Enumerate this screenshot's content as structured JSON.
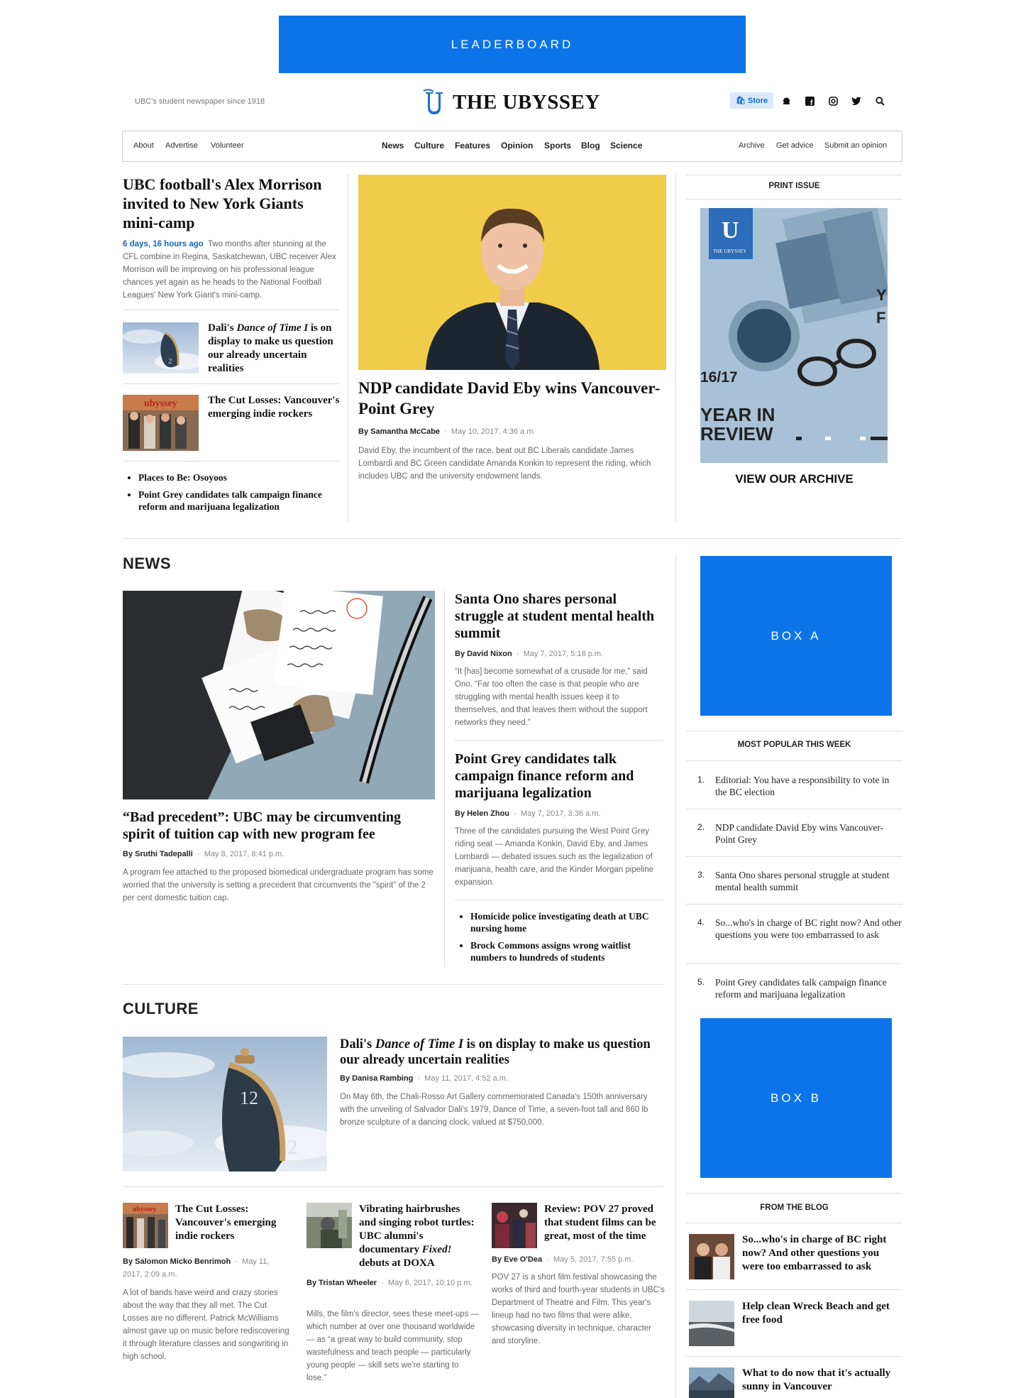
{
  "ads": {
    "leaderboard": "LEADERBOARD",
    "box_a": "BOX A",
    "box_b": "BOX B"
  },
  "header": {
    "tagline": "UBC's student newspaper since 1918",
    "logo_text": "THE UBYSSEY",
    "store_label": "Store",
    "icons": [
      "snapchat-icon",
      "facebook-icon",
      "instagram-icon",
      "twitter-icon",
      "search-icon"
    ]
  },
  "nav": {
    "left": [
      "About",
      "Advertise",
      "Volunteer"
    ],
    "main": [
      "News",
      "Culture",
      "Features",
      "Opinion",
      "Sports",
      "Blog",
      "Science"
    ],
    "right": [
      "Archive",
      "Get advice",
      "Submit an opinion"
    ]
  },
  "top": {
    "left_story": {
      "title": "UBC football's Alex Morrison invited to New York Giants mini-camp",
      "time": "6 days, 16 hours ago",
      "excerpt": "Two months after stunning at the CFL combine in Regina, Saskatchewan, UBC receiver Alex Morrison will be improving on his professional league chances yet again as he heads to the National Football Leagues' New York Giant's mini-camp."
    },
    "thumb_stories": [
      {
        "pre": "Dali's ",
        "em": "Dance of Time I",
        "post": " is on display to make us question our already uncertain realities"
      },
      {
        "pre": "The Cut Losses: Vancouver's emerging indie rockers",
        "em": "",
        "post": ""
      }
    ],
    "bullets": [
      "Places to Be: Osoyoos",
      "Point Grey candidates talk campaign finance reform and marijuana legalization"
    ],
    "feature": {
      "title": "NDP candidate David Eby wins Vancouver-Point Grey",
      "author": "By Samantha McCabe",
      "date": "May 10, 2017, 4:36 a.m.",
      "excerpt": "David Eby, the incumbent of the race, beat out BC Liberals candidate James Lombardi and BC Green candidate Amanda Konkin to represent the riding, which includes UBC and the university endowment lands."
    },
    "print_issue": {
      "heading": "PRINT ISSUE",
      "cover_number": "16/17",
      "cover_title_1": "YEAR IN",
      "cover_title_2": "REVIEW",
      "cover_logo": "THE UBYSSEY",
      "archive_label": "VIEW OUR ARCHIVE"
    }
  },
  "news": {
    "heading": "NEWS",
    "lead": {
      "title": "“Bad precedent”: UBC may be circumventing spirit of tuition cap with new program fee",
      "author": "By Sruthi Tadepalli",
      "date": "May 8, 2017, 8:41 p.m.",
      "excerpt": "A program fee attached to the proposed biomedical undergraduate program has some worried that the university is setting a precedent that circumvents the \"spirit\" of the 2 per cent domestic tuition cap."
    },
    "story1": {
      "title": "Santa Ono shares personal struggle at student mental health summit",
      "author": "By David Nixon",
      "date": "May 7, 2017, 5:18 p.m.",
      "excerpt": "“It [has] become somewhat of a crusade for me,” said Ono. “Far too often the case is that people who are struggling with mental health issues keep it to themselves, and that leaves them without the support networks they need.”"
    },
    "story2": {
      "title": "Point Grey candidates talk campaign finance reform and marijuana legalization",
      "author": "By Helen Zhou",
      "date": "May 7, 2017, 3:36 a.m.",
      "excerpt": "Three of the candidates pursuing the West Point Grey riding seat — Amanda Konkin, David Eby, and James Lombardi — debated issues such as the legalization of marijuana, health care, and the Kinder Morgan pipeline expansion."
    },
    "bullets": [
      "Homicide police investigating death at UBC nursing home",
      "Brock Commons assigns wrong waitlist numbers to hundreds of students"
    ]
  },
  "popular": {
    "heading": "MOST POPULAR THIS WEEK",
    "items": [
      {
        "n": "1.",
        "title": "Editorial: You have a responsibility to vote in the BC election"
      },
      {
        "n": "2.",
        "title": "NDP candidate David Eby wins Vancouver-Point Grey"
      },
      {
        "n": "3.",
        "title": "Santa Ono shares personal struggle at student mental health summit"
      },
      {
        "n": "4.",
        "title": "So...who's in charge of BC right now? And other questions you were too embarrassed to ask"
      },
      {
        "n": "5.",
        "title": "Point Grey candidates talk campaign finance reform and marijuana legalization"
      }
    ]
  },
  "culture": {
    "heading": "CULTURE",
    "lead": {
      "pre": "Dali's ",
      "em": "Dance of Time I",
      "post": " is on display to make us question our already uncertain realities",
      "author": "By Danisa Rambing",
      "date": "May 11, 2017, 4:52 a.m.",
      "excerpt": "On May 6th, the Chali-Rosso Art Gallery commemorated Canada's 150th anniversary with the unveiling of Salvador Dali's 1979, Dance of Time, a seven-foot tall and 860 lb bronze sculpture of a dancing clock, valued at $750,000."
    },
    "cards": [
      {
        "pre": "The Cut Losses: Vancouver's emerging indie rockers",
        "em": "",
        "post": "",
        "author": "By Salomon Micko Benrimoh",
        "date": "May 11, 2017, 2:09 a.m.",
        "excerpt": "A lot of bands have weird and crazy stories about the way that they all met. The Cut Losses are no different. Patrick McWilliams almost gave up on music before rediscovering it through literature classes and songwriting in high school."
      },
      {
        "pre": "Vibrating hairbrushes and singing robot turtles: UBC alumni's documentary ",
        "em": "Fixed!",
        "post": " debuts at DOXA",
        "author": "By Tristan Wheeler",
        "date": "May 6, 2017, 10:10 p.m.",
        "excerpt": "Mills, the film's director, sees these meet-ups — which number at over one thousand worldwide — as “a great way to build community, stop wastefulness and teach people — particularly young people — skill sets we're starting to lose.”"
      },
      {
        "pre": "Review: POV 27 proved that student films can be great, most of the time",
        "em": "",
        "post": "",
        "author": "By Eve O'Dea",
        "date": "May 5, 2017, 7:55 p.m.",
        "excerpt": "POV 27 is a short film festival showcasing the works of third and fourth-year students in UBC's Department of Theatre and Film. This year's lineup had no two films that were alike, showcasing diversity in technique, character and storyline."
      }
    ]
  },
  "blog": {
    "heading": "FROM THE BLOG",
    "items": [
      "So...who's in charge of BC right now? And other questions you were too embarrassed to ask",
      "Help clean Wreck Beach and get free food",
      "What to do now that it's actually sunny in Vancouver"
    ]
  }
}
